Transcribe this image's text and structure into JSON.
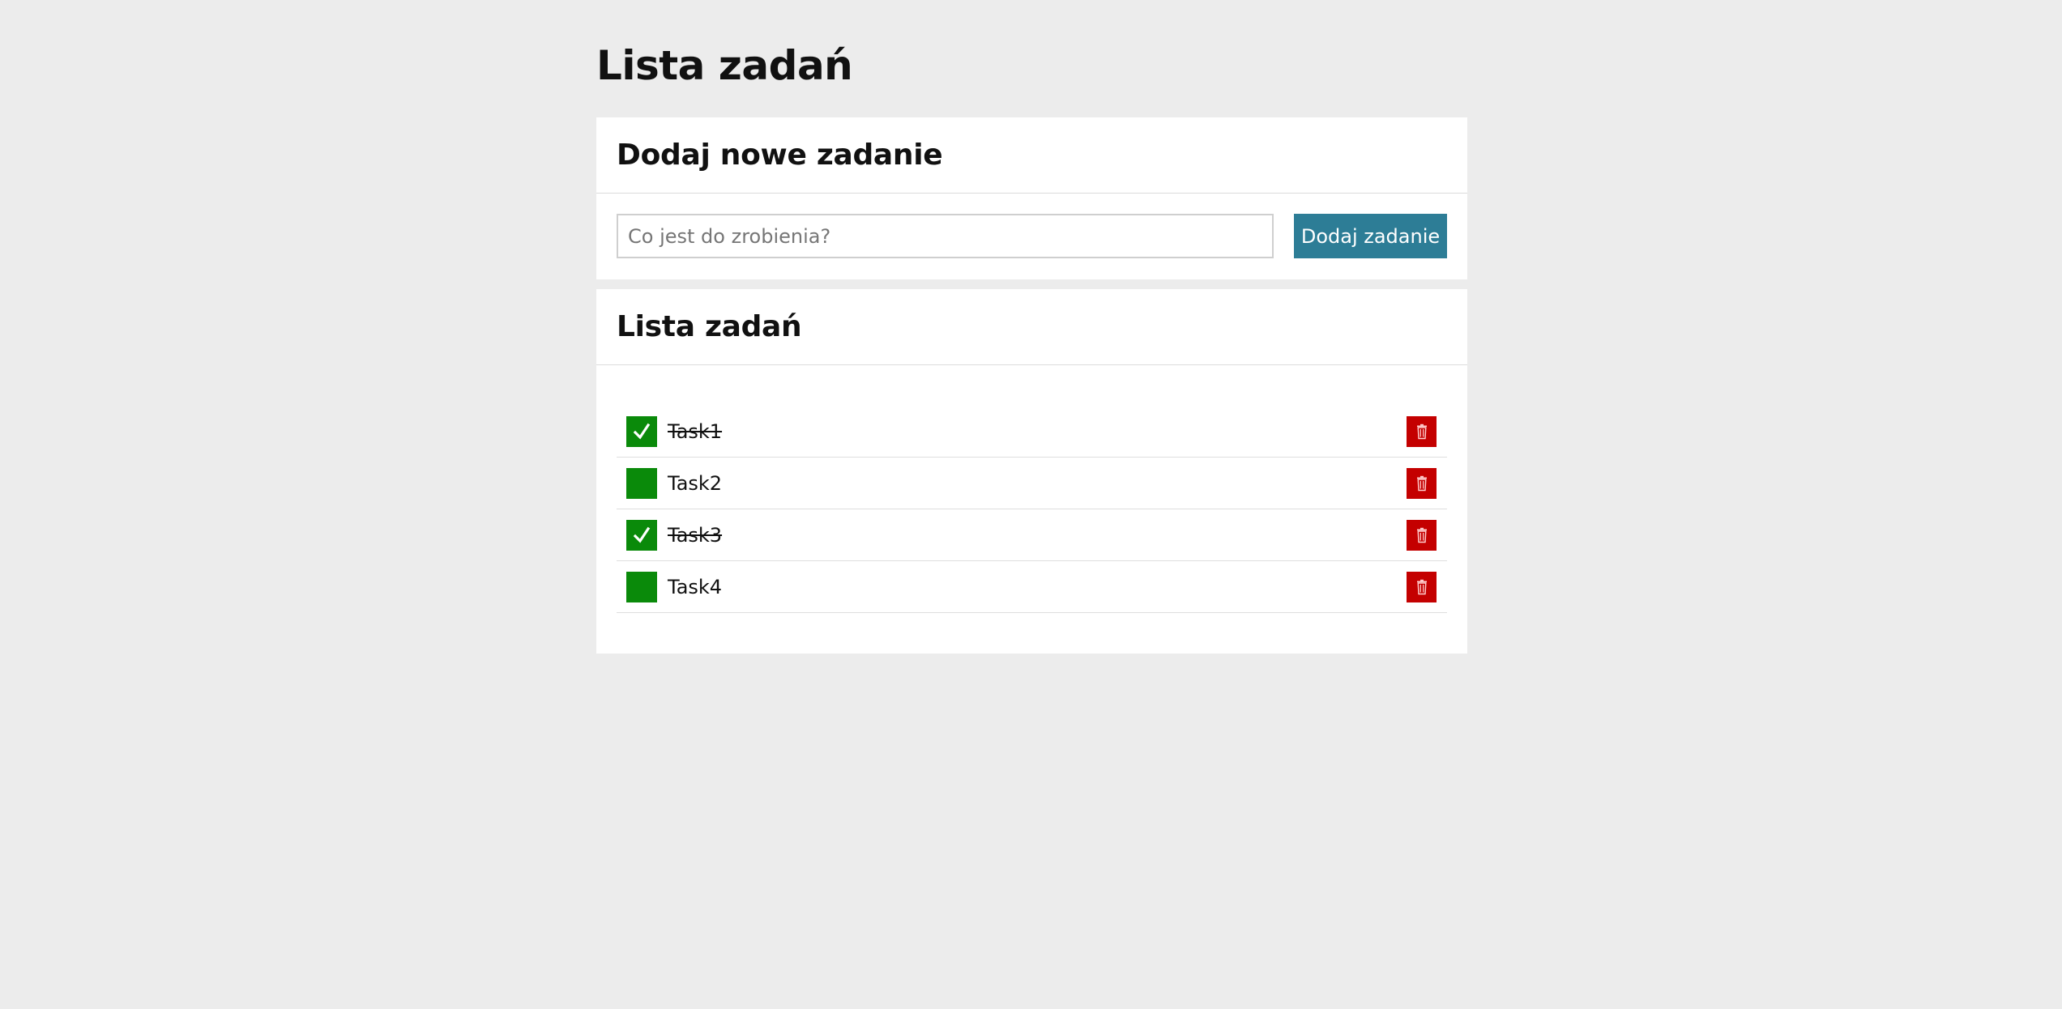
{
  "page": {
    "title": "Lista zadań"
  },
  "add_panel": {
    "heading": "Dodaj nowe zadanie",
    "input_placeholder": "Co jest do zrobienia?",
    "input_value": "",
    "button_label": "Dodaj zadanie"
  },
  "list_panel": {
    "heading": "Lista zadań",
    "tasks": [
      {
        "label": "Task1",
        "done": true
      },
      {
        "label": "Task2",
        "done": false
      },
      {
        "label": "Task3",
        "done": true
      },
      {
        "label": "Task4",
        "done": false
      }
    ]
  },
  "icons": {
    "checkbox": "check-icon",
    "delete": "trash-icon"
  },
  "colors": {
    "background": "#ececec",
    "panel": "#ffffff",
    "accent_button": "#2d7d96",
    "checkbox": "#0a8a0a",
    "delete": "#c40000"
  }
}
